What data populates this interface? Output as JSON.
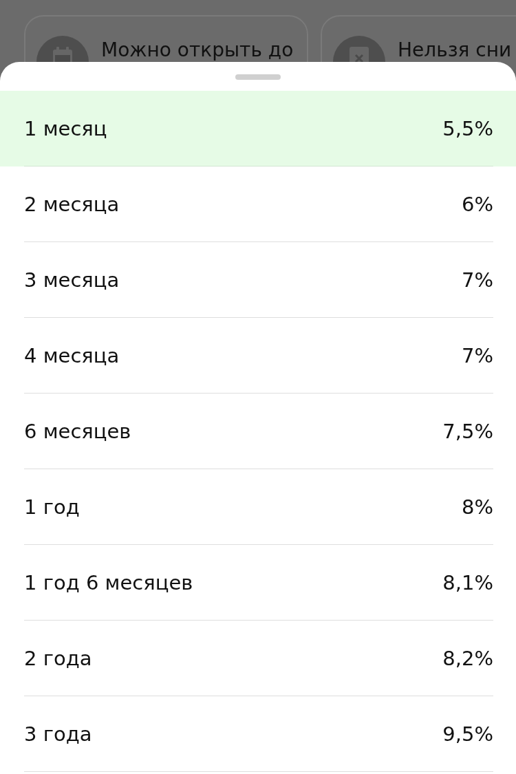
{
  "background_cards": [
    {
      "kind": "calendar",
      "label": "Можно открыть до"
    },
    {
      "kind": "blocked",
      "label": "Нельзя сни"
    }
  ],
  "sheet": {
    "rows": [
      {
        "term": "1 месяц",
        "rate": "5,5%",
        "selected": true
      },
      {
        "term": "2 месяца",
        "rate": "6%",
        "selected": false
      },
      {
        "term": "3 месяца",
        "rate": "7%",
        "selected": false
      },
      {
        "term": "4 месяца",
        "rate": "7%",
        "selected": false
      },
      {
        "term": "6 месяцев",
        "rate": "7,5%",
        "selected": false
      },
      {
        "term": "1 год",
        "rate": "8%",
        "selected": false
      },
      {
        "term": "1 год 6 месяцев",
        "rate": "8,1%",
        "selected": false
      },
      {
        "term": "2 года",
        "rate": "8,2%",
        "selected": false
      },
      {
        "term": "3 года",
        "rate": "9,5%",
        "selected": false
      }
    ]
  }
}
